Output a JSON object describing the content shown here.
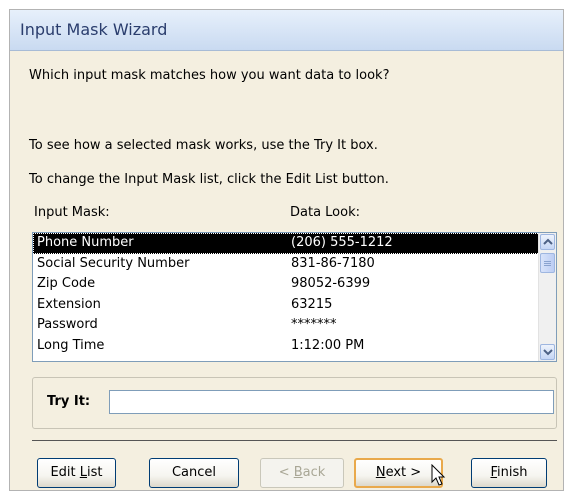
{
  "window": {
    "title": "Input Mask Wizard"
  },
  "instructions": {
    "question": "Which input mask matches how you want data to look?",
    "try_hint": "To see how a selected mask works, use the Try It box.",
    "edit_hint": "To change the Input Mask list, click the Edit List button."
  },
  "list": {
    "col_mask": "Input Mask:",
    "col_look": "Data Look:",
    "rows": [
      {
        "mask": "Phone Number",
        "look": "(206) 555-1212",
        "selected": true
      },
      {
        "mask": "Social Security Number",
        "look": "831-86-7180"
      },
      {
        "mask": "Zip Code",
        "look": "98052-6399"
      },
      {
        "mask": "Extension",
        "look": "63215"
      },
      {
        "mask": "Password",
        "look": "*******"
      },
      {
        "mask": "Long Time",
        "look": "1:12:00 PM"
      }
    ]
  },
  "try_it": {
    "label": "Try It:",
    "value": ""
  },
  "buttons": {
    "edit_list": {
      "pre": "Edit ",
      "key": "L",
      "post": "ist"
    },
    "cancel": "Cancel",
    "back": {
      "pre": "< ",
      "key": "B",
      "post": "ack"
    },
    "next": {
      "key": "N",
      "post": "ext >"
    },
    "finish": {
      "key": "F",
      "post": "inish"
    }
  },
  "colors": {
    "selection": "#000000",
    "title_text": "#2a3d6d",
    "dialog_bg": "#f4efe0",
    "focus_border": "#e9a94b"
  }
}
